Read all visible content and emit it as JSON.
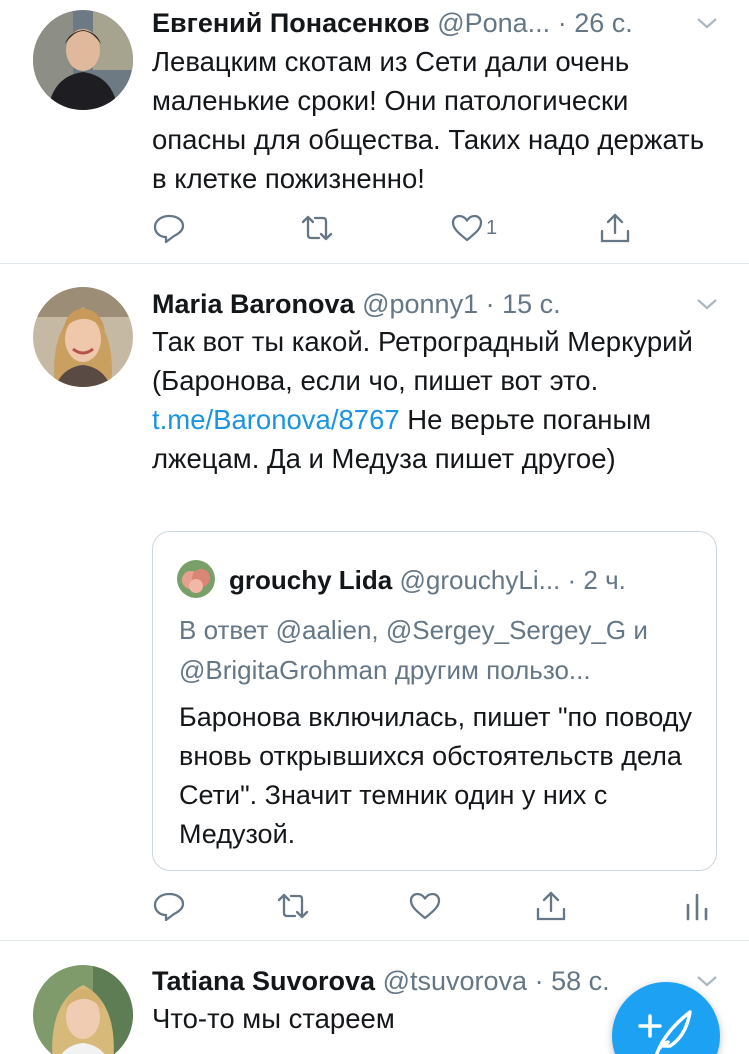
{
  "tweets": [
    {
      "name": "Евгений Понасенков",
      "handle": "@Pona...",
      "time": "· 26 с.",
      "text": "Левацким скотам из Сети дали очень маленькие сроки! Они патологически опасны для общества. Таких надо держать в клетке пожизненно!",
      "like_count": "1"
    },
    {
      "name": "Maria Baronova",
      "handle": "@ponny1",
      "time": "· 15 с.",
      "text_before_link": "Так вот ты какой. Ретроградный Меркурий (Баронова, если чо, пишет вот это. ",
      "link": "t.me/Baronova/8767",
      "text_after_link": " Не верьте поганым лжецам. Да и Медуза пишет другое)",
      "quote": {
        "name": "grouchy Lida",
        "handle": "@grouchyLi...",
        "time": "· 2 ч.",
        "reply_to": "В ответ @aalien, @Sergey_Sergey_G и @BrigitaGrohman другим пользо...",
        "text": "Баронова включилась, пишет \"по поводу вновь открывшихся обстоятельств дела Сети\". Значит темник один у них с Медузой."
      }
    },
    {
      "name": "Tatiana Suvorova",
      "handle": "@tsuvorova",
      "time": "· 58 с.",
      "text": "Что-то мы стареем"
    }
  ],
  "colors": {
    "accent": "#1da1f2",
    "link": "#1b95e0",
    "secondary_text": "#657786",
    "divider": "#e1e8ed"
  },
  "icons": [
    "reply-icon",
    "retweet-icon",
    "like-icon",
    "share-icon",
    "analytics-icon",
    "chevron-down-icon",
    "compose-tweet-icon"
  ]
}
